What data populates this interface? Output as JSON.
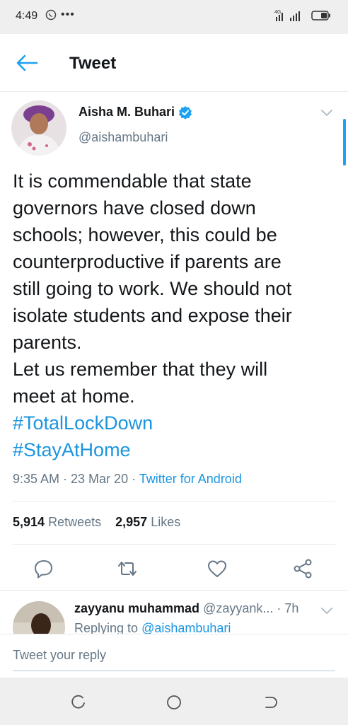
{
  "status_bar": {
    "time": "4:49",
    "dots": "•••",
    "network_label": "4G",
    "icons": [
      "whatsapp-icon",
      "signal-icon",
      "battery-icon"
    ]
  },
  "app_bar": {
    "title": "Tweet",
    "back_icon": "back-arrow-icon"
  },
  "tweet": {
    "author_name": "Aisha M. Buhari",
    "author_handle": "@aishambuhari",
    "verified": true,
    "body_lines": [
      "It is commendable that state",
      "governors have closed down",
      "schools; however, this could be",
      "counterproductive if parents are",
      "still going to work. We should not",
      "isolate students and expose their",
      "parents.",
      "Let us remember that they will",
      "meet at home."
    ],
    "hashtags": [
      "#TotalLockDown",
      "#StayAtHome"
    ],
    "timestamp": "9:35 AM · 23 Mar 20 · ",
    "source": "Twitter for Android",
    "retweets_count": "5,914",
    "retweets_label": "Retweets",
    "likes_count": "2,957",
    "likes_label": "Likes"
  },
  "actions": [
    "reply-icon",
    "retweet-icon",
    "like-icon",
    "share-icon"
  ],
  "reply": {
    "name": "zayyanu muhammad",
    "handle_time": "@zayyank... · 7h",
    "context_prefix": "Replying to ",
    "context_mention": "@aishambuhari"
  },
  "compose": {
    "placeholder": "Tweet your reply"
  },
  "colors": {
    "accent": "#1da1f2",
    "link": "#1b95e0",
    "secondary_text": "#657786",
    "primary_text": "#14171a",
    "system_bar": "#efefef"
  }
}
